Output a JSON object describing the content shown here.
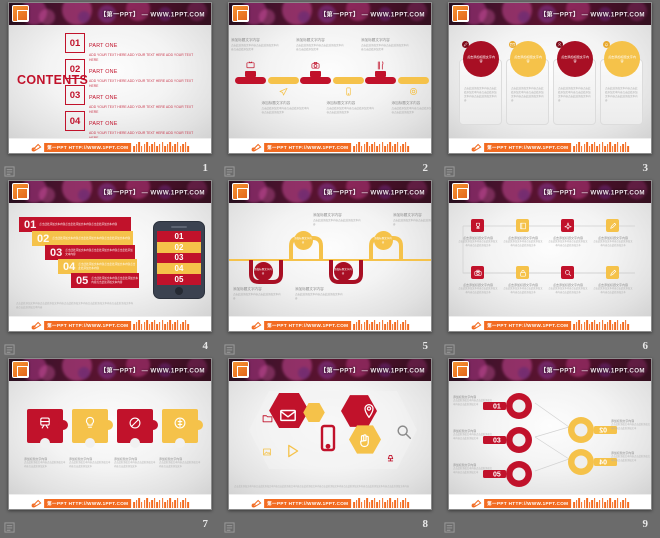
{
  "meta": {
    "header_text": "【第一PPT】 — WWW.1PPT.COM",
    "footer_text": "第一PPT HTTP://WWW.1PPT.COM",
    "colors": {
      "red": "#c1122b",
      "dark_red": "#a80f24",
      "yellow": "#f5c24a",
      "orange": "#f26b21",
      "gray_bg": "#6b6b6b",
      "text_gray": "#a9a9a9"
    }
  },
  "placeholder": {
    "title_cn": "添加标题文字内容",
    "title_cn_short": "标题文字",
    "title_cn_alt": "点击添加标题文字内容",
    "body_cn": "点击此处添加文本内容点击此处添加文本内容点击此处添加文本内容点击此处添加文本内容点击此处添加文本内容",
    "body_cn_short": "点击此处添加文本内容点击此处添加文本内容点击此处添加文本",
    "body_en": "ADD YOUR TEXT HERE ADD YOUR TEXT HERE ADD YOUR TEXT HERE",
    "part_label": "PART ONE"
  },
  "slides": [
    {
      "number": "1",
      "name": "contents-slide",
      "title": "CONTENTS",
      "items": [
        {
          "num": "01",
          "heading": "PART ONE",
          "text": "ADD YOUR TEXT HERE ADD YOUR TEXT HERE ADD YOUR TEXT HERE"
        },
        {
          "num": "02",
          "heading": "PART ONE",
          "text": "ADD YOUR TEXT HERE ADD YOUR TEXT HERE ADD YOUR TEXT HERE"
        },
        {
          "num": "03",
          "heading": "PART ONE",
          "text": "ADD YOUR TEXT HERE ADD YOUR TEXT HERE ADD YOUR TEXT HERE"
        },
        {
          "num": "04",
          "heading": "PART ONE",
          "text": "ADD YOUR TEXT HERE ADD YOUR TEXT HERE ADD YOUR TEXT HERE"
        }
      ]
    },
    {
      "number": "2",
      "name": "timeline-bars-slide",
      "items": [
        {
          "heading": "添加标题文字内容",
          "text": "点击此处添加文本内容点击此处添加文本内容点击此处添加文本",
          "icon": "tv-icon",
          "color": "#c1122b"
        },
        {
          "heading": "添加标题文字内容",
          "text": "点击此处添加文本内容点击此处添加文本内容点击此处添加文本",
          "icon": "paper-plane-icon",
          "color": "#f5c24a"
        },
        {
          "heading": "添加标题文字内容",
          "text": "点击此处添加文本内容点击此处添加文本内容点击此处添加文本",
          "icon": "camera-icon",
          "color": "#c1122b"
        },
        {
          "heading": "添加标题文字内容",
          "text": "点击此处添加文本内容点击此处添加文本内容点击此处添加文本",
          "icon": "mobile-icon",
          "color": "#f5c24a"
        },
        {
          "heading": "添加标题文字内容",
          "text": "点击此处添加文本内容点击此处添加文本内容点击此处添加文本",
          "icon": "cutlery-icon",
          "color": "#c1122b"
        },
        {
          "heading": "添加标题文字内容",
          "text": "点击此处添加文本内容点击此处添加文本内容点击此处添加文本",
          "icon": "target-icon",
          "color": "#f5c24a"
        }
      ]
    },
    {
      "number": "3",
      "name": "circle-cards-slide",
      "items": [
        {
          "heading": "点击添加标题文字内容",
          "text": "点击此处添加文本内容点击此处添加文本内容点击此处添加文本内容点击此处添加文本内容",
          "color": "#a80f24",
          "badge": "pen-icon"
        },
        {
          "heading": "点击添加标题文字内容",
          "text": "点击此处添加文本内容点击此处添加文本内容点击此处添加文本内容点击此处添加文本内容",
          "color": "#f5c24a",
          "badge": "mail-icon"
        },
        {
          "heading": "点击添加标题文字内容",
          "text": "点击此处添加文本内容点击此处添加文本内容点击此处添加文本内容点击此处添加文本内容",
          "color": "#a80f24",
          "badge": "user-icon"
        },
        {
          "heading": "点击添加标题文字内容",
          "text": "点击此处添加文本内容点击此处添加文本内容点击此处添加文本内容点击此处添加文本内容",
          "color": "#f5c24a",
          "badge": "bell-icon"
        }
      ]
    },
    {
      "number": "4",
      "name": "stacked-bars-phone-slide",
      "items": [
        {
          "num": "01",
          "text": "点击此处添加文本内容点击此处添加文本内容点击此处添加文本内容",
          "color": "#c1122b"
        },
        {
          "num": "02",
          "text": "点击此处添加文本内容点击此处添加文本内容点击此处添加文本内容",
          "color": "#f5c24a"
        },
        {
          "num": "03",
          "text": "点击此处添加文本内容点击此处添加文本内容点击此处添加文本内容",
          "color": "#c1122b"
        },
        {
          "num": "04",
          "text": "点击此处添加文本内容点击此处添加文本内容点击此处添加文本内容",
          "color": "#f5c24a"
        },
        {
          "num": "05",
          "text": "点击此处添加文本内容点击此处添加文本内容点击此处添加文本内容",
          "color": "#c1122b"
        }
      ],
      "phone_items": [
        "01",
        "02",
        "03",
        "04",
        "05"
      ],
      "footer_text": "点击此处添加文本内容点击此处添加文本内容点击此处添加文本内容点击此处添加文本内容点击此处添加文本内容点击此处添加文本内容"
    },
    {
      "number": "5",
      "name": "wave-timeline-slide",
      "items": [
        {
          "bubble": "添加标题文字内容",
          "heading": "添加标题文字内容",
          "text": "点击此处添加文本内容点击此处添加文本内容",
          "color": "#a80f24"
        },
        {
          "bubble": "添加标题文字内容",
          "heading": "添加标题文字内容",
          "text": "点击此处添加文本内容点击此处添加文本内容",
          "color": "#f5c24a"
        },
        {
          "bubble": "添加标题文字内容",
          "heading": "添加标题文字内容",
          "text": "点击此处添加文本内容点击此处添加文本内容",
          "color": "#a80f24"
        },
        {
          "bubble": "添加标题文字内容",
          "heading": "添加标题文字内容",
          "text": "点击此处添加文本内容点击此处添加文本内容",
          "color": "#f5c24a"
        }
      ]
    },
    {
      "number": "6",
      "name": "flow-grid-slide",
      "items": [
        {
          "heading": "点击添加标题文字内容",
          "text": "点击此处添加文本内容点击此处添加文本内容点击此处添加文本",
          "icon": "trophy-icon",
          "color": "#c1122b"
        },
        {
          "heading": "点击添加标题文字内容",
          "text": "点击此处添加文本内容点击此处添加文本内容点击此处添加文本",
          "icon": "book-icon",
          "color": "#f5c24a"
        },
        {
          "heading": "点击添加标题文字内容",
          "text": "点击此处添加文本内容点击此处添加文本内容点击此处添加文本",
          "icon": "plane-icon",
          "color": "#c1122b"
        },
        {
          "heading": "点击添加标题文字内容",
          "text": "点击此处添加文本内容点击此处添加文本内容点击此处添加文本",
          "icon": "pencil-icon",
          "color": "#f5c24a"
        },
        {
          "heading": "点击添加标题文字内容",
          "text": "点击此处添加文本内容点击此处添加文本内容点击此处添加文本",
          "icon": "camera-icon",
          "color": "#c1122b"
        },
        {
          "heading": "点击添加标题文字内容",
          "text": "点击此处添加文本内容点击此处添加文本内容点击此处添加文本",
          "icon": "lock-icon",
          "color": "#f5c24a"
        },
        {
          "heading": "点击添加标题文字内容",
          "text": "点击此处添加文本内容点击此处添加文本内容点击此处添加文本",
          "icon": "search-icon",
          "color": "#c1122b"
        },
        {
          "heading": "点击添加标题文字内容",
          "text": "点击此处添加文本内容点击此处添加文本内容点击此处添加文本",
          "icon": "pen-icon",
          "color": "#f5c24a"
        }
      ]
    },
    {
      "number": "7",
      "name": "puzzle-pieces-slide",
      "items": [
        {
          "heading": "添加标题文字内容",
          "text": "点击此处添加文本内容点击此处添加文本内容点击此处添加文本",
          "icon": "train-icon",
          "color": "#c1122b"
        },
        {
          "heading": "添加标题文字内容",
          "text": "点击此处添加文本内容点击此处添加文本内容点击此处添加文本",
          "icon": "bulb-icon",
          "color": "#f5c24a"
        },
        {
          "heading": "添加标题文字内容",
          "text": "点击此处添加文本内容点击此处添加文本内容点击此处添加文本",
          "icon": "no-entry-icon",
          "color": "#c1122b"
        },
        {
          "heading": "添加标题文字内容",
          "text": "点击此处添加文本内容点击此处添加文本内容点击此处添加文本",
          "icon": "coin-icon",
          "color": "#f5c24a"
        }
      ]
    },
    {
      "number": "8",
      "name": "hexagon-icons-slide",
      "icons": [
        "envelope-icon",
        "folder-icon",
        "play-icon",
        "image-icon",
        "mobile-icon",
        "pin-icon",
        "hand-icon",
        "search-icon",
        "lamp-icon"
      ],
      "footer_text": "点击此处添加文本内容点击此处添加文本内容点击此处添加文本内容点击此处添加文本内容点击此处添加文本内容点击此处添加文本内容点击此处添加文本内容点击此处添加文本内容"
    },
    {
      "number": "9",
      "name": "key-diagram-slide",
      "items": [
        {
          "num": "01",
          "heading": "添加标题文字内容",
          "text": "点击此处添加文本内容点击此处添加文本内容点击此处添加文本",
          "color": "#c1122b",
          "side": "left"
        },
        {
          "num": "03",
          "heading": "添加标题文字内容",
          "text": "点击此处添加文本内容点击此处添加文本内容点击此处添加文本",
          "color": "#c1122b",
          "side": "left"
        },
        {
          "num": "05",
          "heading": "添加标题文字内容",
          "text": "点击此处添加文本内容点击此处添加文本内容点击此处添加文本",
          "color": "#c1122b",
          "side": "left"
        },
        {
          "num": "02",
          "heading": "添加标题文字内容",
          "text": "点击此处添加文本内容点击此处添加文本内容点击此处添加文本",
          "color": "#f5c24a",
          "side": "right"
        },
        {
          "num": "04",
          "heading": "添加标题文字内容",
          "text": "点击此处添加文本内容点击此处添加文本内容点击此处添加文本",
          "color": "#f5c24a",
          "side": "right"
        }
      ]
    }
  ]
}
